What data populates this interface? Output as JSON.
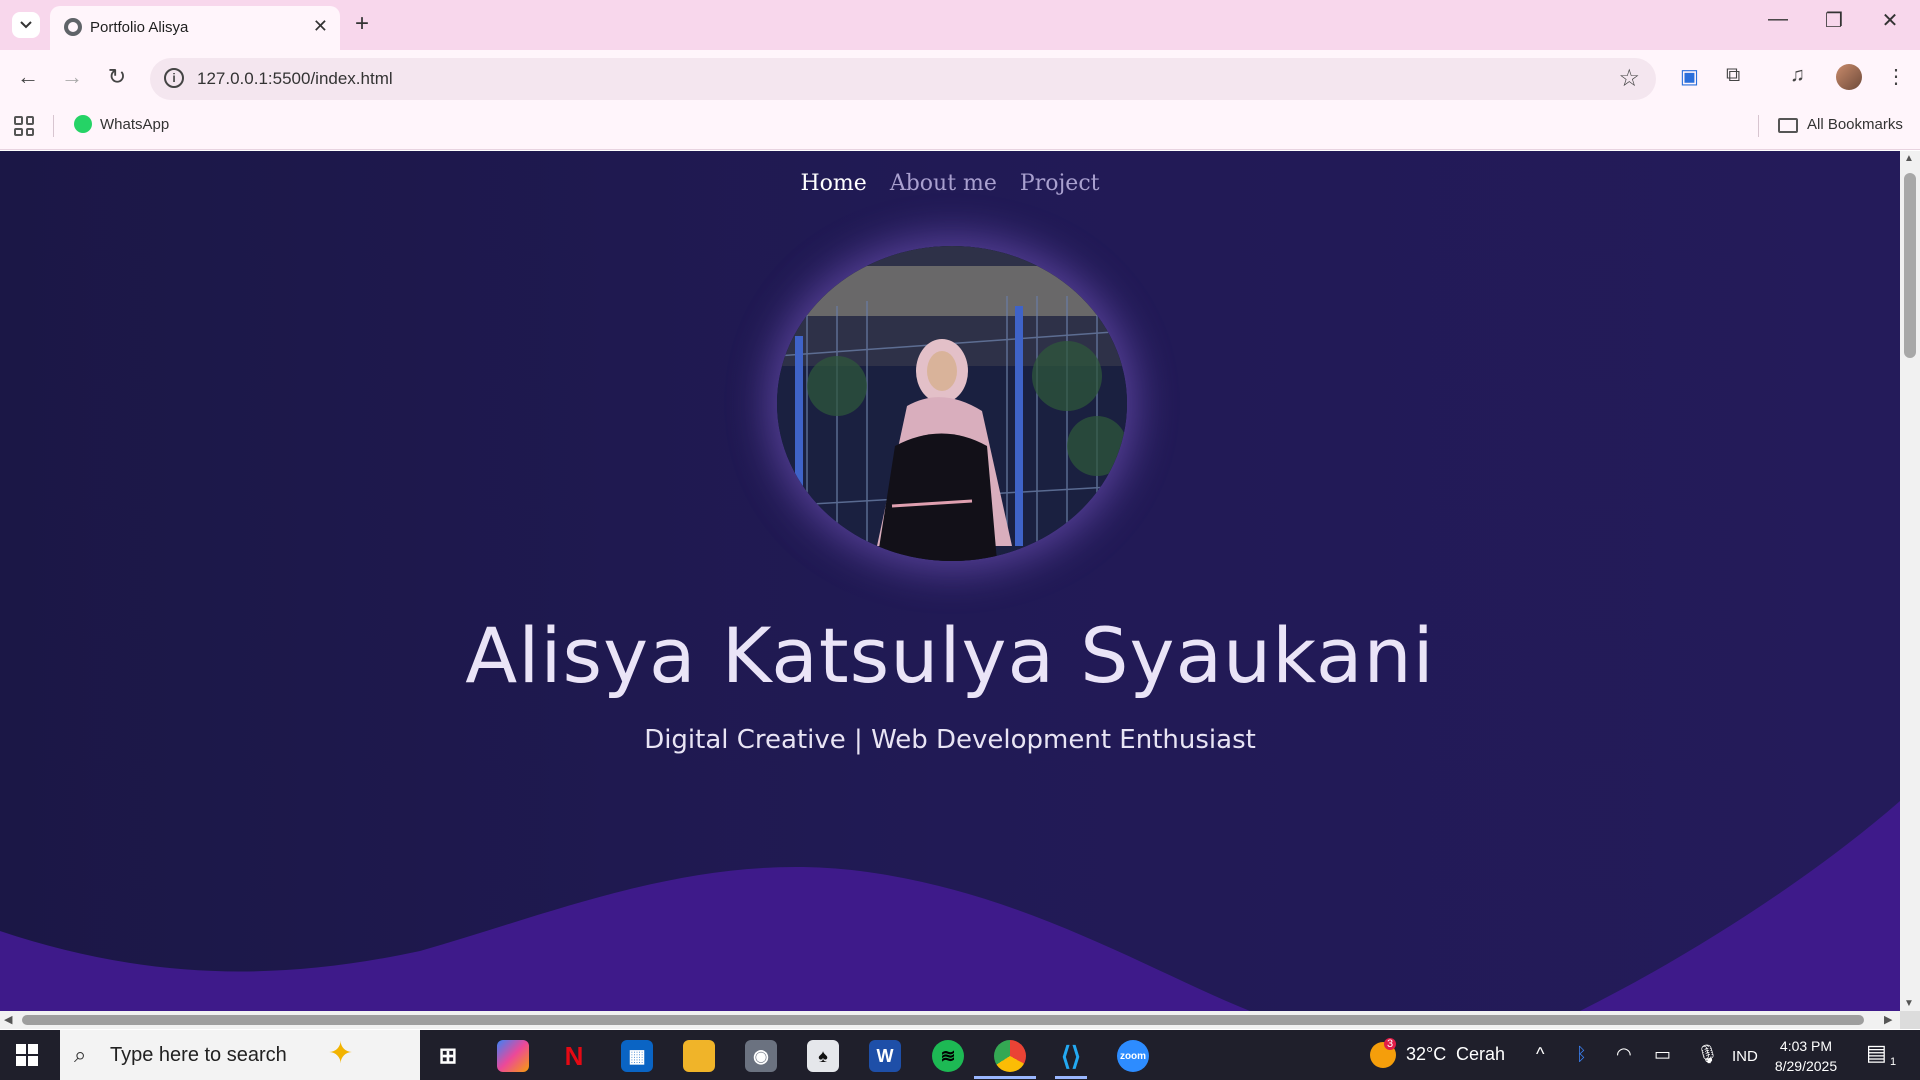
{
  "browser": {
    "tab_title": "Portfolio Alisya",
    "url": "127.0.0.1:5500/index.html",
    "bookmarks": [
      {
        "label": "WhatsApp"
      }
    ],
    "all_bookmarks_label": "All Bookmarks"
  },
  "page": {
    "nav": [
      "Home",
      "About me",
      "Project"
    ],
    "active_nav": "Home",
    "name": "Alisya Katsulya Syaukani",
    "tagline": "Digital Creative | Web Development Enthusiast",
    "colors": {
      "background": "#1f1950",
      "wave": "#3e1a8a",
      "text": "#eae4f7"
    }
  },
  "taskbar": {
    "search_placeholder": "Type here to search",
    "weather_temp": "32°C",
    "weather_desc": "Cerah",
    "weather_badge": "3",
    "language": "IND",
    "time": "4:03 PM",
    "date": "8/29/2025",
    "notification_count": "1"
  }
}
